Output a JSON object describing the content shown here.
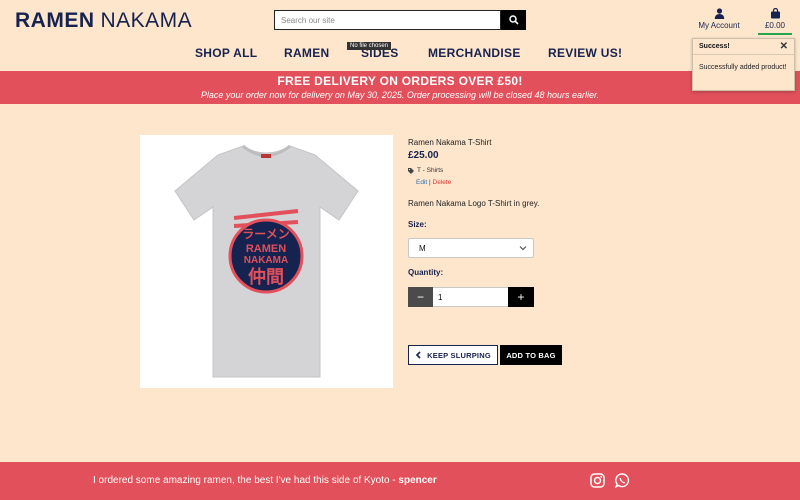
{
  "header": {
    "brand_bold": "RAMEN",
    "brand_light": "NAKAMA",
    "search_placeholder": "Search our site",
    "account_label": "My Account",
    "bag_total": "£0.00"
  },
  "nav": {
    "items": [
      "SHOP ALL",
      "RAMEN",
      "SIDES",
      "MERCHANDISE",
      "REVIEW US!"
    ],
    "tooltip": "No file chosen"
  },
  "toast": {
    "title": "Success!",
    "message": "Successfully added product!"
  },
  "banner": {
    "headline": "FREE DELIVERY ON ORDERS OVER £50!",
    "subline": "Place your order now for delivery on May 30, 2025. Order processing will be closed 48 hours earlier."
  },
  "product": {
    "name": "Ramen Nakama T-Shirt",
    "price": "£25.00",
    "category": "T - Shirts",
    "edit_label": "Edit",
    "separator": "|",
    "delete_label": "Delete",
    "description": "Ramen Nakama Logo T-Shirt in grey.",
    "size_label": "Size:",
    "size_value": "M",
    "quantity_label": "Quantity:",
    "quantity_value": "1",
    "keep_label": "KEEP SLURPING",
    "add_label": "ADD TO BAG",
    "shirt_text": {
      "katakana": "ラーメン",
      "line1": "RAMEN",
      "line2": "NAKAMA",
      "kanji": "仲間"
    }
  },
  "footer": {
    "quote": "I ordered some amazing ramen, the best I've had this side of Kyoto - ",
    "author": "spencer"
  },
  "colors": {
    "background": "#fde6cc",
    "accent_red": "#e1505b",
    "navy": "#16224f",
    "success_green": "#2aa44b"
  },
  "icons": [
    "search-icon",
    "user-icon",
    "shopping-bag-icon",
    "close-icon",
    "tag-icon",
    "chevron-down-icon",
    "chevron-left-icon",
    "instagram-icon",
    "whatsapp-icon"
  ]
}
